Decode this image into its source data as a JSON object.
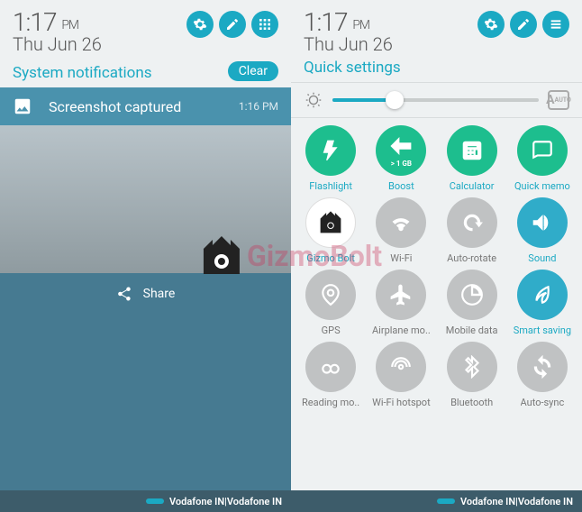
{
  "left": {
    "time": "1:17",
    "ampm": "PM",
    "date": "Thu Jun 26",
    "section": "System notifications",
    "clear": "Clear",
    "notification": {
      "title": "Screenshot captured",
      "timestamp": "1:16 PM"
    },
    "share": "Share",
    "carrier": "Vodafone IN|Vodafone IN"
  },
  "right": {
    "time": "1:17",
    "ampm": "PM",
    "date": "Thu Jun 26",
    "section": "Quick settings",
    "brightness_percent": 30,
    "auto": "AUTO",
    "tiles": [
      {
        "label": "Flashlight",
        "color": "c-green",
        "icon": "flash",
        "active": true
      },
      {
        "label": "Boost",
        "color": "c-green",
        "icon": "boost",
        "active": true,
        "sub": "> 1 GB"
      },
      {
        "label": "Calculator",
        "color": "c-green",
        "icon": "calc",
        "active": true
      },
      {
        "label": "Quick memo",
        "color": "c-green",
        "icon": "memo",
        "active": true
      },
      {
        "label": "Gizmo Bolt",
        "color": "c-white",
        "icon": "gizmo",
        "active": true
      },
      {
        "label": "Wi-Fi",
        "color": "c-grey",
        "icon": "wifi",
        "active": false
      },
      {
        "label": "Auto-rotate",
        "color": "c-grey",
        "icon": "rotate",
        "active": false
      },
      {
        "label": "Sound",
        "color": "c-teal",
        "icon": "sound",
        "active": true
      },
      {
        "label": "GPS",
        "color": "c-grey",
        "icon": "gps",
        "active": false
      },
      {
        "label": "Airplane mo..",
        "color": "c-grey",
        "icon": "plane",
        "active": false
      },
      {
        "label": "Mobile data",
        "color": "c-grey",
        "icon": "data",
        "active": false
      },
      {
        "label": "Smart saving",
        "color": "c-teal",
        "icon": "leaf",
        "active": true
      },
      {
        "label": "Reading mo..",
        "color": "c-grey",
        "icon": "glasses",
        "active": false
      },
      {
        "label": "Wi-Fi hotspot",
        "color": "c-grey",
        "icon": "hotspot",
        "active": false
      },
      {
        "label": "Bluetooth",
        "color": "c-grey",
        "icon": "bt",
        "active": false
      },
      {
        "label": "Auto-sync",
        "color": "c-grey",
        "icon": "sync",
        "active": false
      }
    ],
    "carrier": "Vodafone IN|Vodafone IN"
  },
  "watermark": "GizmoBolt",
  "colors": {
    "teal": "#1ba9c3",
    "green": "#1dbe8e",
    "grey": "#c0c2c3"
  }
}
